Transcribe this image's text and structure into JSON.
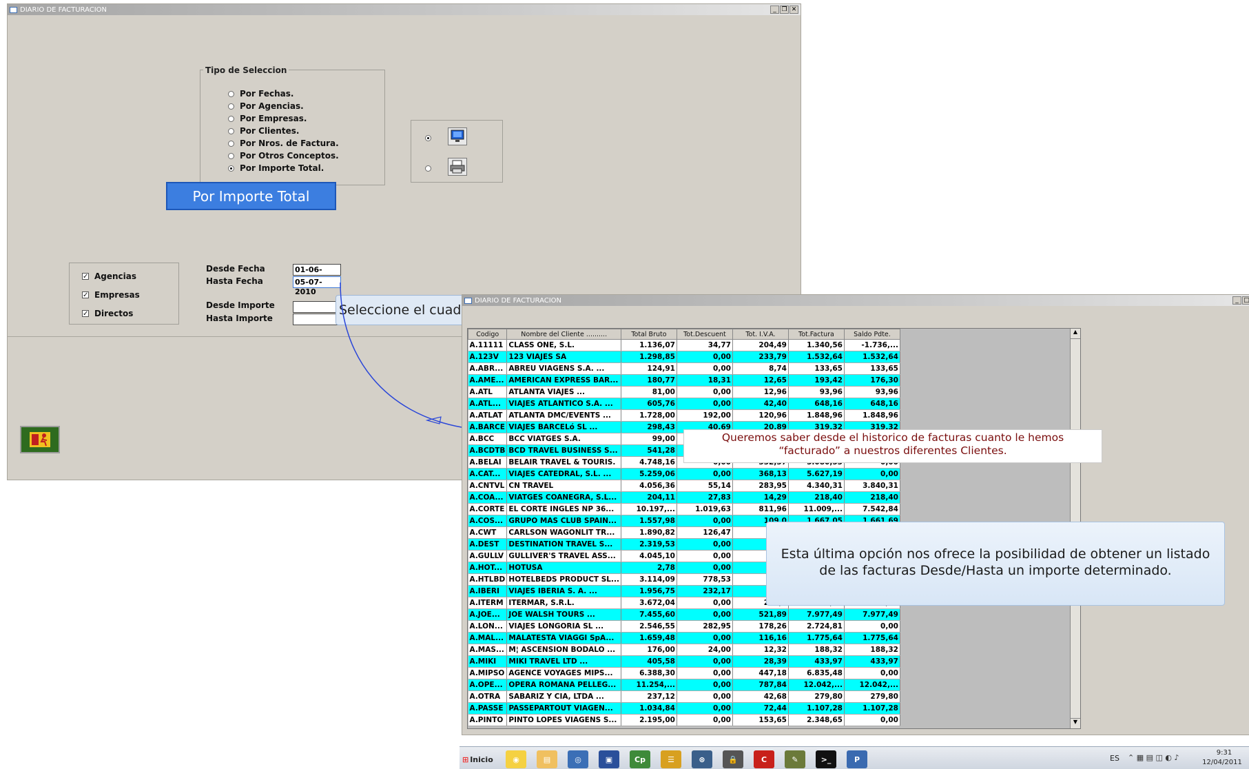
{
  "main_window": {
    "title": "DIARIO DE FACTURACION",
    "controls": {
      "minimize": "_",
      "restore": "❐",
      "close": "✕"
    }
  },
  "selection_group": {
    "legend": "Tipo de Seleccion",
    "options": [
      {
        "label": "Por Fechas.",
        "selected": false
      },
      {
        "label": "Por Agencias.",
        "selected": false
      },
      {
        "label": "Por Empresas.",
        "selected": false
      },
      {
        "label": "Por Clientes.",
        "selected": false
      },
      {
        "label": "Por Nros. de Factura.",
        "selected": false
      },
      {
        "label": "Por Otros Conceptos.",
        "selected": false
      },
      {
        "label": "Por Importe Total.",
        "selected": true
      }
    ]
  },
  "output_group": {
    "options": [
      {
        "icon": "monitor-icon",
        "selected": true
      },
      {
        "icon": "printer-icon",
        "selected": false
      }
    ]
  },
  "highlight_button": {
    "label": "Por Importe Total"
  },
  "type_checkboxes": [
    {
      "label": "Agencias",
      "checked": true
    },
    {
      "label": "Empresas",
      "checked": true
    },
    {
      "label": "Directos",
      "checked": true
    }
  ],
  "filters": {
    "desde_fecha_label": "Desde  Fecha",
    "hasta_fecha_label": "Hasta  Fecha",
    "desde_fecha_value": "01-06-2010",
    "hasta_fecha_value": "05-07-2010",
    "desde_importe_label": "Desde  Importe",
    "hasta_importe_label": "Hasta  Importe",
    "desde_importe_value": "",
    "hasta_importe_value": ""
  },
  "tooltip_partial": "Seleccione el cuad",
  "result_window": {
    "title": "DIARIO DE FACTURACION",
    "columns": [
      "Codigo",
      "Nombre del Cliente ..........",
      "Total Bruto",
      "Tot.Descuent",
      "Tot. I.V.A.",
      "Tot.Factura",
      "Saldo Pdte."
    ],
    "rows": [
      [
        "A.11111",
        "CLASS ONE, S.L.",
        "1.136,07",
        "34,77",
        "204,49",
        "1.340,56",
        "-1.736,..."
      ],
      [
        "A.123V",
        "123 VIAJES SA",
        "1.298,85",
        "0,00",
        "233,79",
        "1.532,64",
        "1.532,64"
      ],
      [
        "A.ABR...",
        "ABREU VIAGENS S.A.      ...",
        "124,91",
        "0,00",
        "8,74",
        "133,65",
        "133,65"
      ],
      [
        "A.AME...",
        "AMERICAN EXPRESS BAR...",
        "180,77",
        "18,31",
        "12,65",
        "193,42",
        "176,30"
      ],
      [
        "A.ATL",
        "ATLANTA VIAJES         ...",
        "81,00",
        "0,00",
        "12,96",
        "93,96",
        "93,96"
      ],
      [
        "A.ATL...",
        "VIAJES ATLANTICO S.A. ...",
        "605,76",
        "0,00",
        "42,40",
        "648,16",
        "648,16"
      ],
      [
        "A.ATLAT",
        "ATLANTA DMC/EVENTS ...",
        "1.728,00",
        "192,00",
        "120,96",
        "1.848,96",
        "1.848,96"
      ],
      [
        "A.BARCE",
        "VIAJES BARCELó SL      ...",
        "298,43",
        "40,69",
        "20,89",
        "319,32",
        "319,32"
      ],
      [
        "A.BCC",
        "BCC VIATGES S.A.",
        "99,00",
        "",
        "",
        "",
        ""
      ],
      [
        "A.BCDTB",
        "BCD TRAVEL BUSINESS S...",
        "541,28",
        "",
        "",
        "",
        ""
      ],
      [
        "A.BELAI",
        "BELAIR TRAVEL & TOURIS.",
        "4.748,16",
        "0,00",
        "332,37",
        "5.080,53",
        "0,00"
      ],
      [
        "A.CAT...",
        "VIAJES CATEDRAL, S.L. ...",
        "5.259,06",
        "0,00",
        "368,13",
        "5.627,19",
        "0,00"
      ],
      [
        "A.CNTVL",
        "CN TRAVEL",
        "4.056,36",
        "55,14",
        "283,95",
        "4.340,31",
        "3.840,31"
      ],
      [
        "A.COA...",
        "VIATGES COANEGRA, S.L...",
        "204,11",
        "27,83",
        "14,29",
        "218,40",
        "218,40"
      ],
      [
        "A.CORTE",
        "EL CORTE INGLES NP 36...",
        "10.197,...",
        "1.019,63",
        "811,96",
        "11.009,...",
        "7.542,84"
      ],
      [
        "A.COS...",
        "GRUPO MAS CLUB SPAIN...",
        "1.557,98",
        "0,00",
        "109,0",
        "1.667,05",
        "1.661,69"
      ],
      [
        "A.CWT",
        "CARLSON WAGONLIT TR...",
        "1.890,82",
        "126,47",
        "163,",
        "",
        ""
      ],
      [
        "A.DEST",
        "DESTINATION TRAVEL S...",
        "2.319,53",
        "0,00",
        "162,",
        "",
        ""
      ],
      [
        "A.GULLV",
        "GULLIVER'S TRAVEL ASS...",
        "4.045,10",
        "0,00",
        "283,",
        "",
        ""
      ],
      [
        "A.HOT...",
        "HOTUSA",
        "2,78",
        "0,00",
        "0,",
        "",
        ""
      ],
      [
        "A.HTLBD",
        "HOTELBEDS PRODUCT SL...",
        "3.114,09",
        "778,53",
        "217,",
        "",
        ""
      ],
      [
        "A.IBERI",
        "VIAJES IBERIA S. A.    ...",
        "1.956,75",
        "232,17",
        "144,",
        "",
        ""
      ],
      [
        "A.ITERM",
        "ITERMAR, S.R.L.",
        "3.672,04",
        "0,00",
        "257,0",
        "3.929,04",
        "3.929,04"
      ],
      [
        "A.JOE...",
        "JOE WALSH TOURS       ...",
        "7.455,60",
        "0,00",
        "521,89",
        "7.977,49",
        "7.977,49"
      ],
      [
        "A.LON...",
        "VIAJES LONGORIA SL    ...",
        "2.546,55",
        "282,95",
        "178,26",
        "2.724,81",
        "0,00"
      ],
      [
        "A.MAL...",
        "MALATESTA VIAGGI SpA...",
        "1.659,48",
        "0,00",
        "116,16",
        "1.775,64",
        "1.775,64"
      ],
      [
        "A.MAS...",
        "M¦ ASCENSION BODALO ...",
        "176,00",
        "24,00",
        "12,32",
        "188,32",
        "188,32"
      ],
      [
        "A.MIKI",
        "MIKI TRAVEL LTD        ...",
        "405,58",
        "0,00",
        "28,39",
        "433,97",
        "433,97"
      ],
      [
        "A.MIPSO",
        "AGENCE VOYAGES MIPS...",
        "6.388,30",
        "0,00",
        "447,18",
        "6.835,48",
        "0,00"
      ],
      [
        "A.OPE...",
        "OPERA ROMANA PELLEG...",
        "11.254,...",
        "0,00",
        "787,84",
        "12.042,...",
        "12.042,..."
      ],
      [
        "A.OTRA",
        "SABARIZ Y CIA, LTDA     ...",
        "237,12",
        "0,00",
        "42,68",
        "279,80",
        "279,80"
      ],
      [
        "A.PASSE",
        "PASSEPARTOUT VIAGEN...",
        "1.034,84",
        "0,00",
        "72,44",
        "1.107,28",
        "1.107,28"
      ],
      [
        "A.PINTO",
        "PINTO LOPES VIAGENS S...",
        "2.195,00",
        "0,00",
        "153,65",
        "2.348,65",
        "0,00"
      ]
    ]
  },
  "callout_top": "Queremos saber desde el historico de facturas cuanto le hemos “facturado” a nuestros diferentes Clientes.",
  "callout_bottom": "Esta última opción nos ofrece la posibilidad de obtener un listado de las facturas Desde/Hasta un importe determinado.",
  "taskbar": {
    "start_label": "Inicio",
    "apps": [
      "chrome-icon",
      "folder-icon",
      "thunderbird-icon",
      "save-icon",
      "captivate-icon",
      "fusion-icon",
      "app-icon",
      "lock-icon",
      "c-icon",
      "notes-icon",
      "cmd-icon",
      "p-icon"
    ],
    "language": "ES",
    "time": "9:31",
    "date": "12/04/2011"
  }
}
